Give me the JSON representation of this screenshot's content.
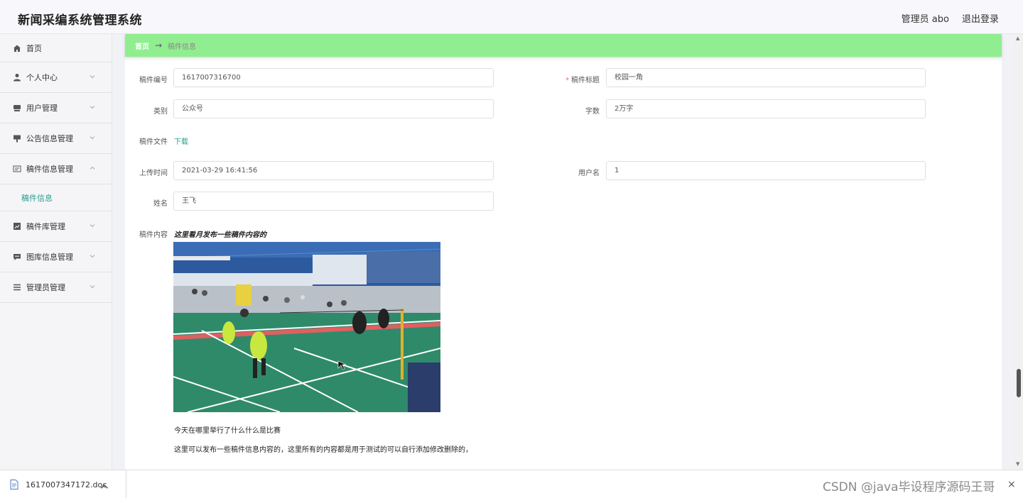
{
  "header": {
    "app_title": "新闻采编系统管理系统",
    "user_label": "管理员 abo",
    "logout_label": "退出登录"
  },
  "sidebar": {
    "items": [
      {
        "label": "首页",
        "icon": "home-icon"
      },
      {
        "label": "个人中心",
        "icon": "user-icon"
      },
      {
        "label": "用户管理",
        "icon": "user-management-icon"
      },
      {
        "label": "公告信息管理",
        "icon": "notice-icon"
      },
      {
        "label": "稿件信息管理",
        "icon": "manuscript-icon",
        "expanded": true
      },
      {
        "label": "稿件库管理",
        "icon": "chart-icon"
      },
      {
        "label": "图库信息管理",
        "icon": "chat-icon"
      },
      {
        "label": "管理员管理",
        "icon": "list-icon"
      }
    ],
    "submenu": {
      "label": "稿件信息"
    }
  },
  "breadcrumb": {
    "home": "首页",
    "arrow": "→",
    "current": "稿件信息"
  },
  "form": {
    "manuscript_no": {
      "label": "稿件编号",
      "value": "1617007316700"
    },
    "title": {
      "label": "稿件标题",
      "value": "校园一角",
      "required_mark": "*"
    },
    "category": {
      "label": "类别",
      "value": "公众号"
    },
    "word_count": {
      "label": "字数",
      "value": "2万字"
    },
    "file": {
      "label": "稿件文件",
      "link": "下载"
    },
    "upload_time": {
      "label": "上传时间",
      "value": "2021-03-29 16:41:56"
    },
    "username": {
      "label": "用户名",
      "value": "1"
    },
    "name": {
      "label": "姓名",
      "value": "王飞"
    },
    "content": {
      "label": "稿件内容",
      "heading": "这里看月发布一些稿件内容的",
      "paragraph1": "今天在哪里举行了什么什么是比赛",
      "paragraph2": "这里可以发布一些稿件信息内容的，这里所有的内容都是用于测试的可以自行添加修改删除的，"
    }
  },
  "download_bar": {
    "filename": "1617007347172.doc",
    "watermark": "CSDN @java毕设程序源码王哥",
    "close": "×"
  },
  "colors": {
    "breadcrumb_bg": "#90ee90",
    "accent": "#2a9d8f",
    "required": "#f56c6c"
  }
}
